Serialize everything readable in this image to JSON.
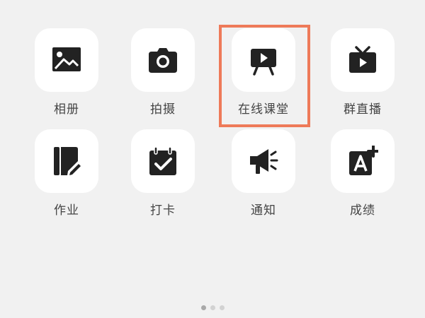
{
  "apps": [
    {
      "label": "相册",
      "icon": "photo-album-icon"
    },
    {
      "label": "拍摄",
      "icon": "camera-icon"
    },
    {
      "label": "在线课堂",
      "icon": "online-classroom-icon"
    },
    {
      "label": "群直播",
      "icon": "group-live-tv-icon"
    },
    {
      "label": "作业",
      "icon": "homework-icon"
    },
    {
      "label": "打卡",
      "icon": "check-in-calendar-icon"
    },
    {
      "label": "通知",
      "icon": "announcement-megaphone-icon"
    },
    {
      "label": "成绩",
      "icon": "grades-icon"
    }
  ],
  "highlight": {
    "target": "在线课堂",
    "color": "#ee7a59"
  },
  "pager": {
    "pages": 3,
    "active": 1
  },
  "colors": {
    "icon": "#222222",
    "tile": "#ffffff",
    "background": "#f1f1f1"
  }
}
